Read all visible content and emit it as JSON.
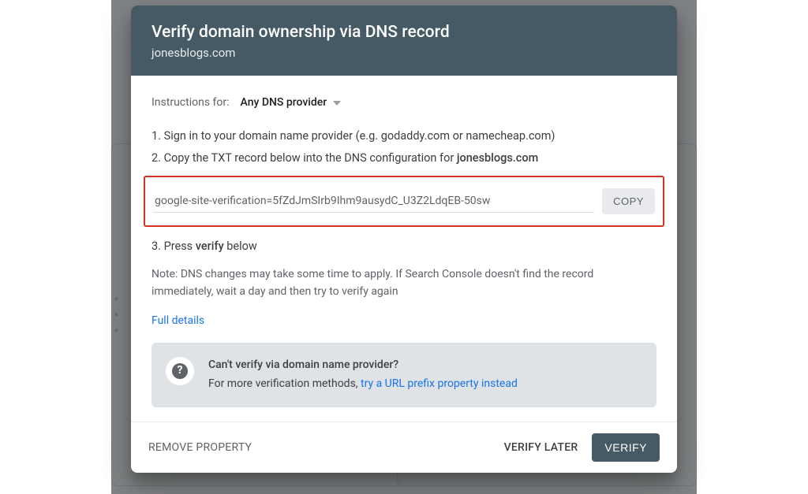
{
  "header": {
    "title": "Verify domain ownership via DNS record",
    "domain": "jonesblogs.com"
  },
  "provider": {
    "label": "Instructions for:",
    "selected": "Any DNS provider"
  },
  "steps": {
    "one_prefix": "1. ",
    "one_text": "Sign in to your domain name provider (e.g. godaddy.com or namecheap.com)",
    "two_prefix": "2. ",
    "two_text": "Copy the TXT record below into the DNS configuration for ",
    "two_domain": "jonesblogs.com",
    "three_prefix": "3. ",
    "three_pre": "Press ",
    "three_bold": "verify",
    "three_post": " below"
  },
  "txt_record": {
    "value": "google-site-verification=5fZdJmSIrb9Ihm9ausydC_U3Z2LdqEB-50sw",
    "copy_label": "COPY"
  },
  "note": "Note: DNS changes may take some time to apply. If Search Console doesn't find the record immediately, wait a day and then try to verify again",
  "full_details": "Full details",
  "banner": {
    "title": "Can't verify via domain name provider?",
    "text": "For more verification methods, ",
    "link": "try a URL prefix property instead"
  },
  "footer": {
    "remove": "REMOVE PROPERTY",
    "later": "VERIFY LATER",
    "verify": "VERIFY"
  }
}
